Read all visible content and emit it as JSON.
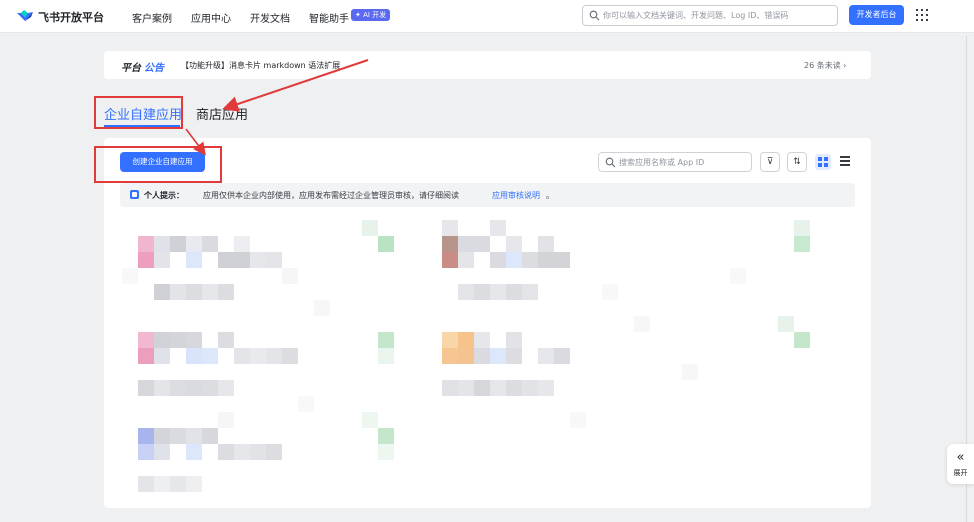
{
  "topbar": {
    "brand": "飞书开放平台",
    "nav": [
      "客户案例",
      "应用中心",
      "开发文档",
      "智能助手"
    ],
    "ai_badge": "✦ AI 开发",
    "search_placeholder": "你可以输入文档关键词、开发问题、Log ID、错误码",
    "dev_console": "开发者后台"
  },
  "announcement": {
    "label_a": "平台",
    "label_b": "公告",
    "text": "【功能升级】消息卡片 markdown 语法扩展",
    "more": "26 条未读 ›"
  },
  "tabs": {
    "internal": "企业自建应用",
    "store": "商店应用"
  },
  "panel": {
    "create_button": "创建企业自建应用",
    "search_placeholder": "搜索应用名称或 App ID",
    "filter_icon": "⊽",
    "sort_icon": "⇅",
    "notice_title": "个人提示：",
    "notice_text": "应用仅供本企业内部使用，应用发布需经过企业管理员审核，请仔细阅读",
    "notice_link": "应用审核说明",
    "notice_tail": "。"
  },
  "side": {
    "expand_icon": "«",
    "expand_label": "展开"
  },
  "colors": {
    "accent": "#3370ff",
    "annotation": "#e03a3a"
  }
}
